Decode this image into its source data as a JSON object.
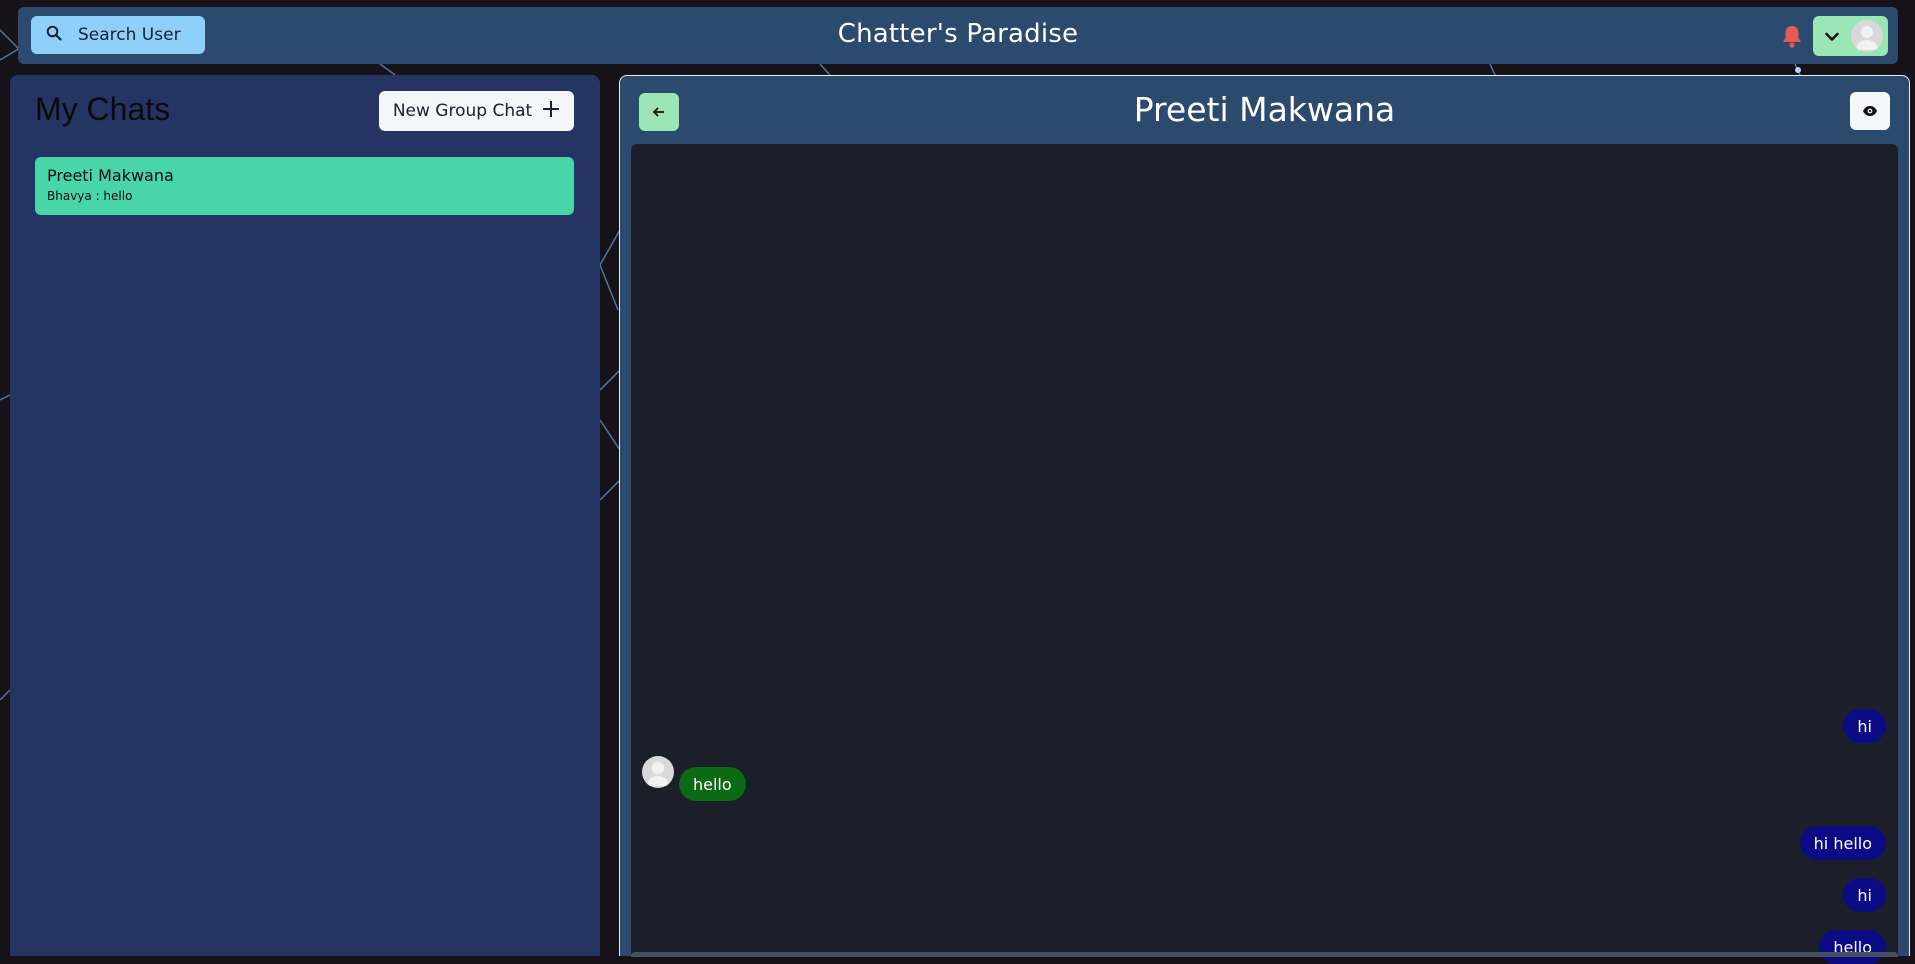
{
  "header": {
    "search_label": "Search User",
    "app_title": "Chatter's Paradise"
  },
  "left_panel": {
    "heading": "My Chats",
    "new_group_label": "New Group Chat",
    "chats": [
      {
        "name": "Preeti Makwana",
        "latest": "Bhavya : hello"
      }
    ]
  },
  "chat": {
    "title": "Preeti Makwana",
    "messages": [
      {
        "text": "hi",
        "direction": "sent"
      },
      {
        "text": "hello",
        "direction": "received"
      },
      {
        "text": "hi hello",
        "direction": "sent"
      },
      {
        "text": "hi",
        "direction": "sent"
      },
      {
        "text": "hello",
        "direction": "sent"
      }
    ]
  },
  "colors": {
    "header_bg": "#2c4a6e",
    "sidebar_bg": "#243563",
    "chat_item_selected": "#48d6a8",
    "sent_bubble": "#0b0b86",
    "received_bubble": "#0c6a14",
    "notification": "#e85a5a"
  },
  "icons": [
    "search-icon",
    "bell-icon",
    "chevron-down-icon",
    "user-avatar-icon",
    "plus-icon",
    "arrow-left-icon",
    "eye-icon"
  ]
}
